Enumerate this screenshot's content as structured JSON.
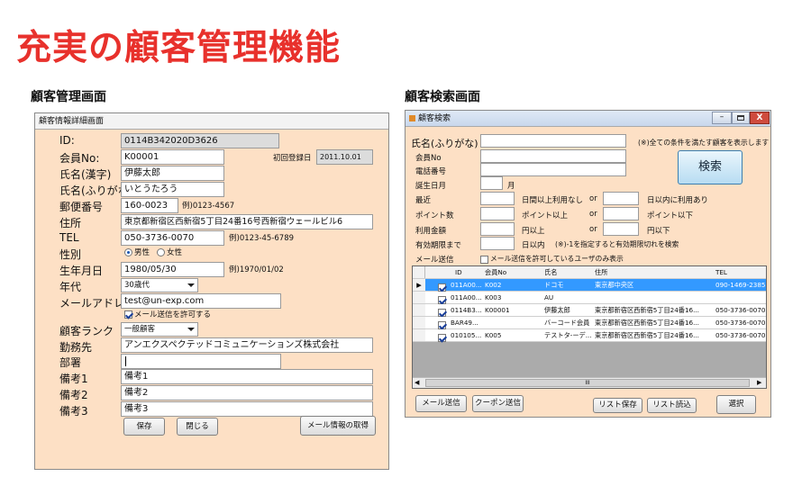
{
  "page": {
    "title": "充実の顧客管理機能",
    "left_caption": "顧客管理画面",
    "right_caption": "顧客検索画面"
  },
  "detail": {
    "window_title": "顧客情報詳細画面",
    "labels": {
      "id": "ID:",
      "member_no": "会員No:",
      "name_kanji": "氏名(漢字)",
      "name_kana": "氏名(ふりがな)",
      "postal": "郵便番号",
      "address": "住所",
      "tel": "TEL",
      "gender": "性別",
      "birth": "生年月日",
      "age_group": "年代",
      "email": "メールアドレス",
      "rank": "顧客ランク",
      "workplace": "勤務先",
      "department": "部署",
      "note1": "備考1",
      "note2": "備考2",
      "note3": "備考3",
      "first_login": "初回登録日"
    },
    "values": {
      "id": "0114B342020D3626",
      "member_no": "K00001",
      "name_kanji": "伊藤太郎",
      "name_kana": "いとうたろう",
      "postal": "160-0023",
      "address": "東京都新宿区西新宿5丁目24番16号西新宿ウェールビル6",
      "tel": "050-3736-0070",
      "birth": "1980/05/30",
      "age_group": "30歳代",
      "email": "test@un-exp.com",
      "rank": "一般顧客",
      "workplace": "アンエクスペクテッドコミュニケーションズ株式会社",
      "department": "",
      "note1": "備考1",
      "note2": "備考2",
      "note3": "備考3",
      "first_login": "2011.10.01"
    },
    "hints": {
      "postal": "例)0123-4567",
      "tel": "例)0123-45-6789",
      "birth": "例)1970/01/02"
    },
    "gender_options": {
      "male": "男性",
      "female": "女性"
    },
    "allow_mail": "メール送信を許可する",
    "buttons": {
      "save": "保存",
      "close": "閉じる",
      "get_mail": "メール情報の取得"
    }
  },
  "search": {
    "window_title": "顧客検索",
    "labels": {
      "name_kana": "氏名(ふりがな)",
      "member_no": "会員No",
      "tel": "電話番号",
      "birth_month": "誕生日月",
      "month_suffix": "月",
      "recent": "最近",
      "recent_not_used": "日間以上利用なし",
      "recent_used": "日以内に利用あり",
      "points": "ポイント数",
      "points_above": "ポイント以上",
      "points_below": "ポイント以下",
      "amount": "利用金額",
      "yen_above": "円以上",
      "yen_below": "円以下",
      "expire": "有効期限まで",
      "within_days": "日以内",
      "expire_note": "(※)-1を指定すると有効期限切れを検索",
      "mail_send": "メール送信",
      "mail_only": "メール送信を許可しているユーザのみ表示",
      "or": "or"
    },
    "note_all": "(※)全ての条件を満たす顧客を表示します",
    "search_button": "検索",
    "columns": [
      "",
      "ID",
      "会員No",
      "氏名",
      "住所",
      "TEL"
    ],
    "rows": [
      {
        "checked": true,
        "selected": true,
        "id": "011A00...",
        "member_no": "K002",
        "name": "ドコモ",
        "address": "東京都中央区",
        "tel": "090-1469-2385"
      },
      {
        "checked": true,
        "selected": false,
        "id": "011A00...",
        "member_no": "K003",
        "name": "AU",
        "address": "",
        "tel": ""
      },
      {
        "checked": true,
        "selected": false,
        "id": "0114B3...",
        "member_no": "K00001",
        "name": "伊藤太郎",
        "address": "東京都新宿区西新宿5丁目24番16...",
        "tel": "050-3736-0070"
      },
      {
        "checked": true,
        "selected": false,
        "id": "BAR49...",
        "member_no": "",
        "name": "バーコード会員",
        "address": "東京都新宿区西新宿5丁目24番16...",
        "tel": "050-3736-0070"
      },
      {
        "checked": true,
        "selected": false,
        "id": "010105...",
        "member_no": "K005",
        "name": "テストタ-ーデ...",
        "address": "東京都新宿区西新宿5丁目24番16...",
        "tel": "050-3736-0070"
      }
    ],
    "buttons": {
      "mail": "メール送信",
      "coupon": "クーポン送信",
      "list_save": "リスト保存",
      "list_load": "リスト読込",
      "select": "選択"
    },
    "scrollbar_marker": "III"
  }
}
